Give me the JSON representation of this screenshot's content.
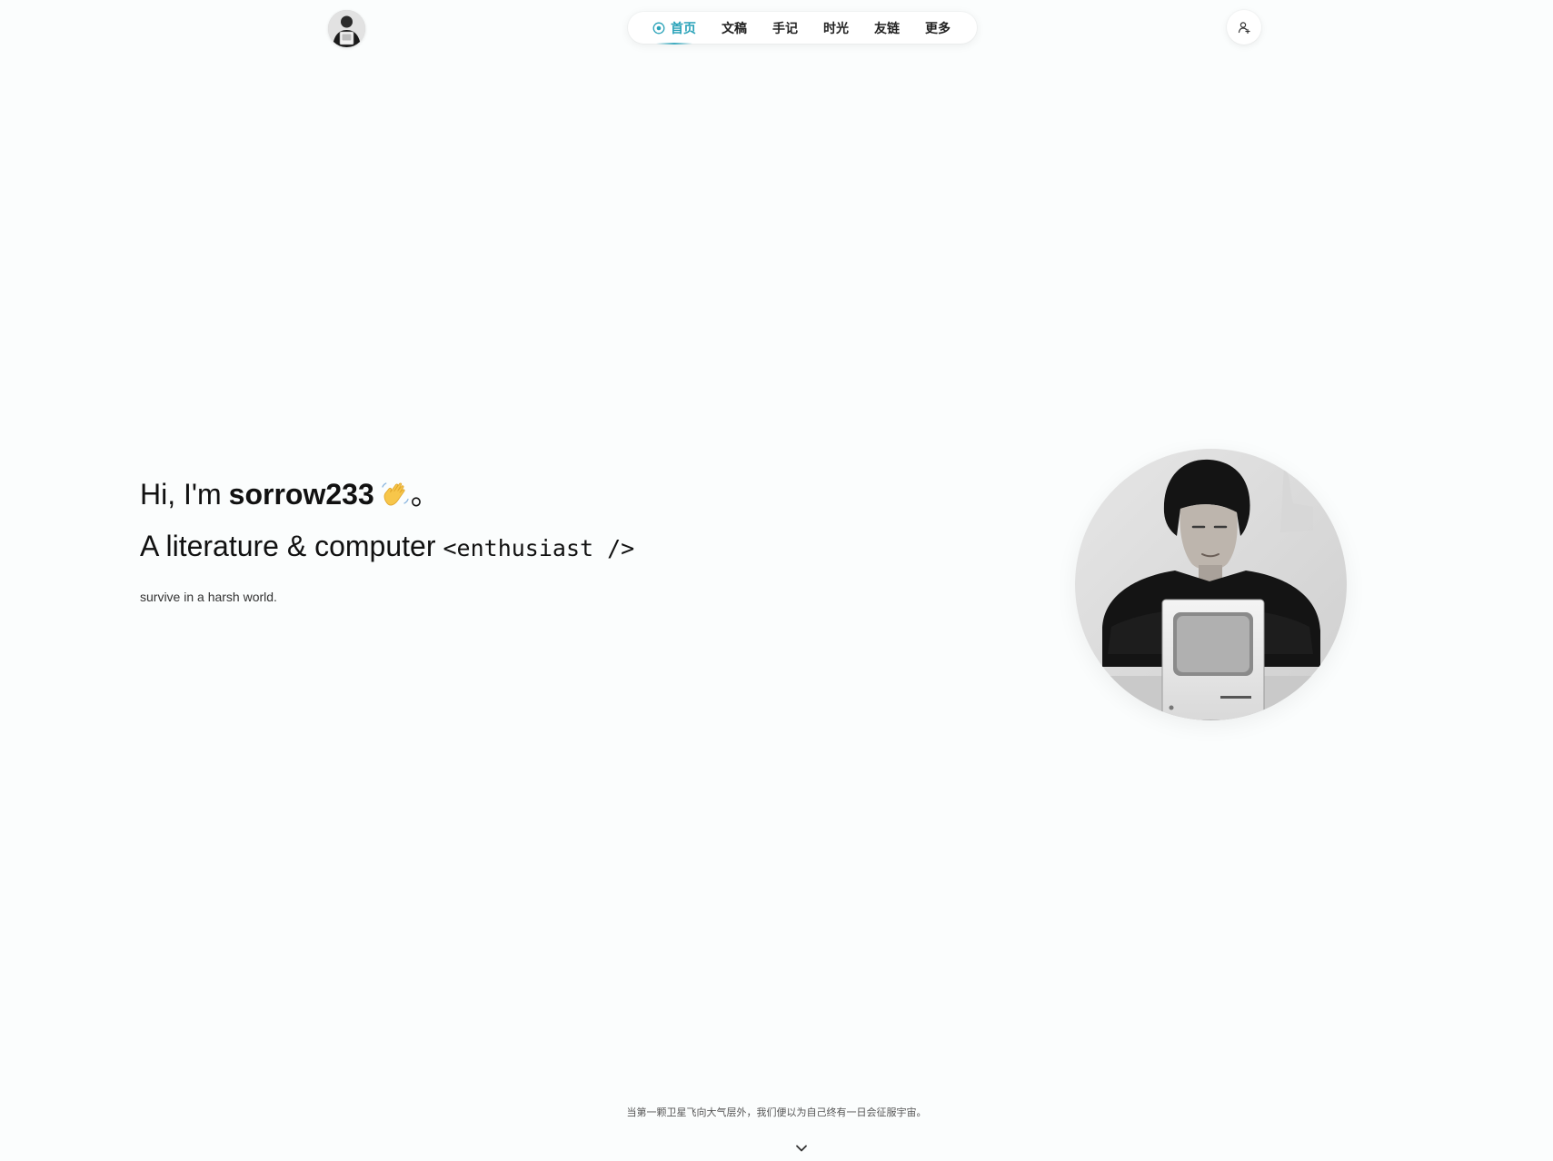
{
  "header": {
    "avatar_alt": "site avatar",
    "nav": [
      {
        "label": "首页",
        "active": true,
        "icon": "target-icon"
      },
      {
        "label": "文稿",
        "active": false
      },
      {
        "label": "手记",
        "active": false
      },
      {
        "label": "时光",
        "active": false
      },
      {
        "label": "友链",
        "active": false
      },
      {
        "label": "更多",
        "active": false
      }
    ],
    "user_icon": "user-icon"
  },
  "hero": {
    "greeting": "Hi, I'm",
    "name": "sorrow233",
    "wave_icon": "waving-hand-icon",
    "greeting_end": "。",
    "role_text": "A literature & computer",
    "role_code": "<enthusiast />",
    "tagline": "survive in a harsh world."
  },
  "footer": {
    "quote": "当第一颗卫星飞向大气层外，我们便以为自己终有一日会征服宇宙。",
    "scroll_icon": "chevron-down-icon"
  },
  "colors": {
    "accent": "#2aa3b9",
    "background": "#fbfdfd",
    "text": "#111111"
  }
}
